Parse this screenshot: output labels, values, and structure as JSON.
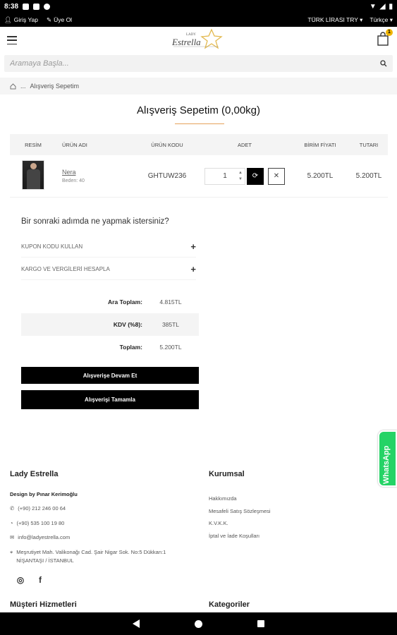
{
  "status": {
    "time": "8:38"
  },
  "topbar": {
    "login": "Giriş Yap",
    "signup": "Üye Ol",
    "currency": "TÜRK LİRASI TRY ▾",
    "language": "Türkçe ▾"
  },
  "header": {
    "cart_count": "1"
  },
  "search": {
    "placeholder": "Aramaya Başla..."
  },
  "breadcrumb": {
    "sep": "...",
    "current": "Alışveriş Sepetim"
  },
  "title": "Alışveriş Sepetim  (0,00kg)",
  "table": {
    "headers": [
      "RESİM",
      "ÜRÜN ADI",
      "ÜRÜN KODU",
      "ADET",
      "BİRİM FİYATI",
      "TUTARI"
    ],
    "rows": [
      {
        "name": "Nera",
        "size": "Beden: 40",
        "code": "GHTUW236",
        "qty": "1",
        "unit_price": "5.200TL",
        "total": "5.200TL"
      }
    ]
  },
  "next_step": {
    "question": "Bir sonraki adımda ne yapmak istersiniz?",
    "coupon": "KUPON KODU KULLAN",
    "shipping": "KARGO VE VERGİLERİ HESAPLA"
  },
  "totals": {
    "subtotal_label": "Ara Toplam:",
    "subtotal": "4.815TL",
    "vat_label": "KDV (%8):",
    "vat": "385TL",
    "total_label": "Toplam:",
    "total": "5.200TL"
  },
  "buttons": {
    "continue": "Alışverişe Devam Et",
    "checkout": "Alışverişi Tamamla"
  },
  "whatsapp": "WhatsApp",
  "footer": {
    "brand": "Lady Estrella",
    "design_by": "Design by Pınar Kerimoğlu",
    "phone": "(+90) 212 246 00 64",
    "whatsapp_phone": "(+90) 535 100 19 80",
    "email": "info@ladyestrella.com",
    "address1": "Meşrutiyet Mah. Valikonağı Cad. Şair Nigar Sok. No:5 Dükkan:1",
    "address2": "NİŞANTAŞI / İSTANBUL",
    "corporate_title": "Kurumsal",
    "corporate_links": [
      "Hakkımızda",
      "Mesafeli Satış Sözleşmesi",
      "K.V.K.K.",
      "İptal ve İade Koşulları"
    ],
    "customer_title": "Müşteri Hizmetleri",
    "categories_title": "Kategoriler"
  }
}
